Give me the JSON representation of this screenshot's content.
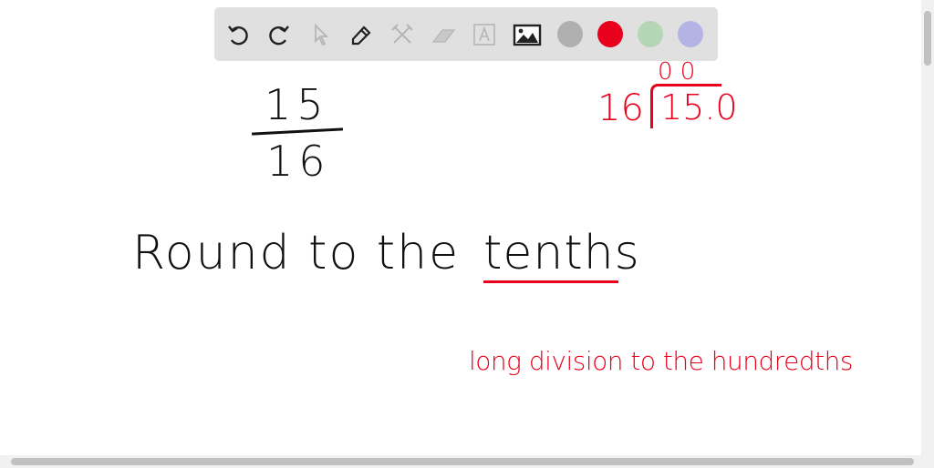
{
  "toolbar": {
    "tools": [
      "undo-icon",
      "redo-icon",
      "select-icon",
      "pen-icon",
      "tools-icon",
      "eraser-icon",
      "text-icon",
      "image-icon"
    ],
    "colors": [
      "#b0b0b0",
      "#e8001c",
      "#b5d6b5",
      "#b5b3e6"
    ]
  },
  "canvas": {
    "fraction_numerator": "15",
    "fraction_denominator": "16",
    "instruction_prefix": "Round to the",
    "instruction_keyword": "tenths",
    "division_divisor": "16",
    "division_dividend": "15.0",
    "division_quotient": "0 0",
    "note": "long division to the hundredths"
  }
}
